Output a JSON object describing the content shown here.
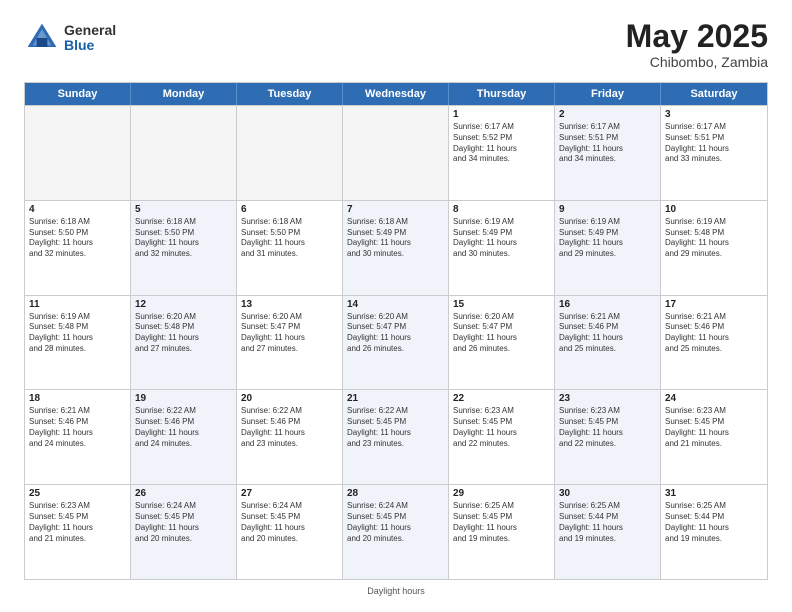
{
  "header": {
    "logo_general": "General",
    "logo_blue": "Blue",
    "month_year": "May 2025",
    "location": "Chibombo, Zambia"
  },
  "days": [
    "Sunday",
    "Monday",
    "Tuesday",
    "Wednesday",
    "Thursday",
    "Friday",
    "Saturday"
  ],
  "footer": "Daylight hours",
  "weeks": [
    [
      {
        "day": "",
        "info": ""
      },
      {
        "day": "",
        "info": ""
      },
      {
        "day": "",
        "info": ""
      },
      {
        "day": "",
        "info": ""
      },
      {
        "day": "1",
        "info": "Sunrise: 6:17 AM\nSunset: 5:52 PM\nDaylight: 11 hours\nand 34 minutes."
      },
      {
        "day": "2",
        "info": "Sunrise: 6:17 AM\nSunset: 5:51 PM\nDaylight: 11 hours\nand 34 minutes."
      },
      {
        "day": "3",
        "info": "Sunrise: 6:17 AM\nSunset: 5:51 PM\nDaylight: 11 hours\nand 33 minutes."
      }
    ],
    [
      {
        "day": "4",
        "info": "Sunrise: 6:18 AM\nSunset: 5:50 PM\nDaylight: 11 hours\nand 32 minutes."
      },
      {
        "day": "5",
        "info": "Sunrise: 6:18 AM\nSunset: 5:50 PM\nDaylight: 11 hours\nand 32 minutes."
      },
      {
        "day": "6",
        "info": "Sunrise: 6:18 AM\nSunset: 5:50 PM\nDaylight: 11 hours\nand 31 minutes."
      },
      {
        "day": "7",
        "info": "Sunrise: 6:18 AM\nSunset: 5:49 PM\nDaylight: 11 hours\nand 30 minutes."
      },
      {
        "day": "8",
        "info": "Sunrise: 6:19 AM\nSunset: 5:49 PM\nDaylight: 11 hours\nand 30 minutes."
      },
      {
        "day": "9",
        "info": "Sunrise: 6:19 AM\nSunset: 5:49 PM\nDaylight: 11 hours\nand 29 minutes."
      },
      {
        "day": "10",
        "info": "Sunrise: 6:19 AM\nSunset: 5:48 PM\nDaylight: 11 hours\nand 29 minutes."
      }
    ],
    [
      {
        "day": "11",
        "info": "Sunrise: 6:19 AM\nSunset: 5:48 PM\nDaylight: 11 hours\nand 28 minutes."
      },
      {
        "day": "12",
        "info": "Sunrise: 6:20 AM\nSunset: 5:48 PM\nDaylight: 11 hours\nand 27 minutes."
      },
      {
        "day": "13",
        "info": "Sunrise: 6:20 AM\nSunset: 5:47 PM\nDaylight: 11 hours\nand 27 minutes."
      },
      {
        "day": "14",
        "info": "Sunrise: 6:20 AM\nSunset: 5:47 PM\nDaylight: 11 hours\nand 26 minutes."
      },
      {
        "day": "15",
        "info": "Sunrise: 6:20 AM\nSunset: 5:47 PM\nDaylight: 11 hours\nand 26 minutes."
      },
      {
        "day": "16",
        "info": "Sunrise: 6:21 AM\nSunset: 5:46 PM\nDaylight: 11 hours\nand 25 minutes."
      },
      {
        "day": "17",
        "info": "Sunrise: 6:21 AM\nSunset: 5:46 PM\nDaylight: 11 hours\nand 25 minutes."
      }
    ],
    [
      {
        "day": "18",
        "info": "Sunrise: 6:21 AM\nSunset: 5:46 PM\nDaylight: 11 hours\nand 24 minutes."
      },
      {
        "day": "19",
        "info": "Sunrise: 6:22 AM\nSunset: 5:46 PM\nDaylight: 11 hours\nand 24 minutes."
      },
      {
        "day": "20",
        "info": "Sunrise: 6:22 AM\nSunset: 5:46 PM\nDaylight: 11 hours\nand 23 minutes."
      },
      {
        "day": "21",
        "info": "Sunrise: 6:22 AM\nSunset: 5:45 PM\nDaylight: 11 hours\nand 23 minutes."
      },
      {
        "day": "22",
        "info": "Sunrise: 6:23 AM\nSunset: 5:45 PM\nDaylight: 11 hours\nand 22 minutes."
      },
      {
        "day": "23",
        "info": "Sunrise: 6:23 AM\nSunset: 5:45 PM\nDaylight: 11 hours\nand 22 minutes."
      },
      {
        "day": "24",
        "info": "Sunrise: 6:23 AM\nSunset: 5:45 PM\nDaylight: 11 hours\nand 21 minutes."
      }
    ],
    [
      {
        "day": "25",
        "info": "Sunrise: 6:23 AM\nSunset: 5:45 PM\nDaylight: 11 hours\nand 21 minutes."
      },
      {
        "day": "26",
        "info": "Sunrise: 6:24 AM\nSunset: 5:45 PM\nDaylight: 11 hours\nand 20 minutes."
      },
      {
        "day": "27",
        "info": "Sunrise: 6:24 AM\nSunset: 5:45 PM\nDaylight: 11 hours\nand 20 minutes."
      },
      {
        "day": "28",
        "info": "Sunrise: 6:24 AM\nSunset: 5:45 PM\nDaylight: 11 hours\nand 20 minutes."
      },
      {
        "day": "29",
        "info": "Sunrise: 6:25 AM\nSunset: 5:45 PM\nDaylight: 11 hours\nand 19 minutes."
      },
      {
        "day": "30",
        "info": "Sunrise: 6:25 AM\nSunset: 5:44 PM\nDaylight: 11 hours\nand 19 minutes."
      },
      {
        "day": "31",
        "info": "Sunrise: 6:25 AM\nSunset: 5:44 PM\nDaylight: 11 hours\nand 19 minutes."
      }
    ]
  ]
}
